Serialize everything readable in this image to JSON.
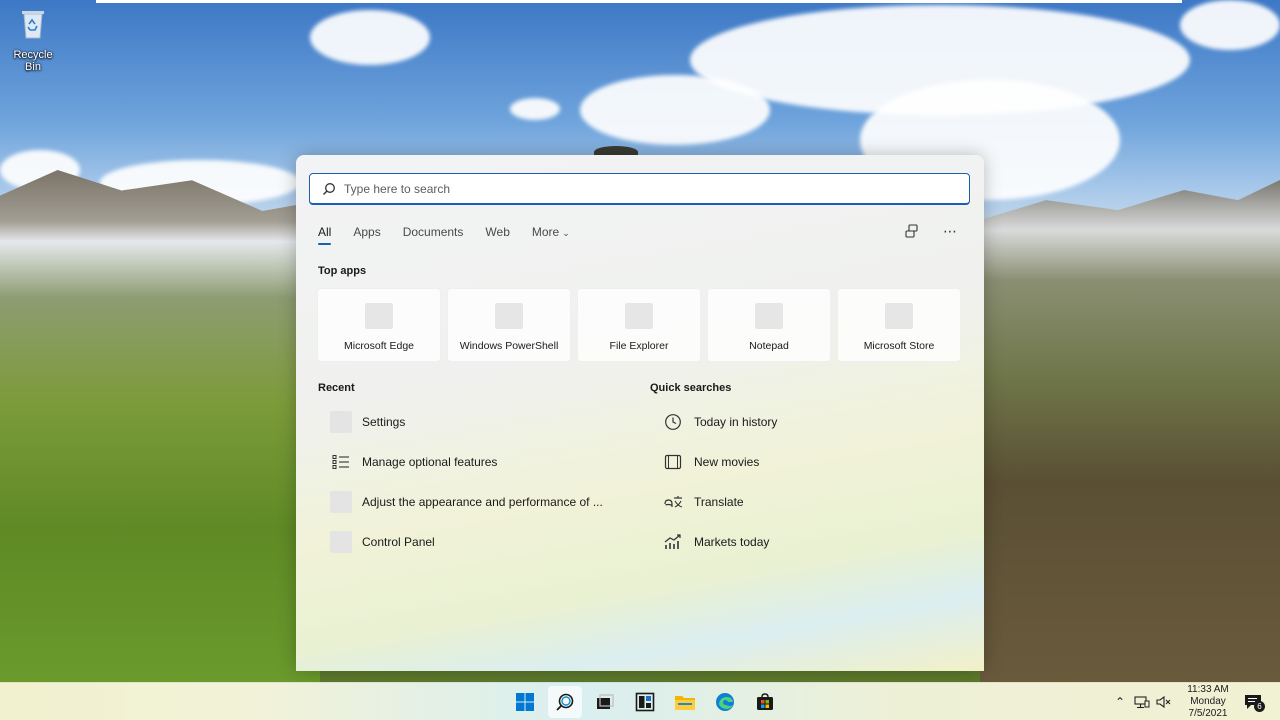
{
  "desktop": {
    "recycle_bin_label": "Recycle Bin"
  },
  "search": {
    "placeholder": "Type here to search",
    "tabs": [
      {
        "label": "All",
        "active": true
      },
      {
        "label": "Apps"
      },
      {
        "label": "Documents"
      },
      {
        "label": "Web"
      },
      {
        "label": "More"
      }
    ],
    "actions": [
      {
        "icon": "connected-accounts-icon"
      },
      {
        "icon": "more-options-icon"
      }
    ]
  },
  "top_apps": {
    "title": "Top apps",
    "items": [
      {
        "label": "Microsoft Edge"
      },
      {
        "label": "Windows PowerShell"
      },
      {
        "label": "File Explorer"
      },
      {
        "label": "Notepad"
      },
      {
        "label": "Microsoft Store"
      }
    ]
  },
  "recent": {
    "title": "Recent",
    "items": [
      {
        "label": "Settings",
        "icon": "settings-placeholder-icon"
      },
      {
        "label": "Manage optional features",
        "icon": "list-icon"
      },
      {
        "label": "Adjust the appearance and performance of ...",
        "icon": "performance-placeholder-icon"
      },
      {
        "label": "Control Panel",
        "icon": "control-panel-placeholder-icon"
      }
    ]
  },
  "quick_searches": {
    "title": "Quick searches",
    "items": [
      {
        "label": "Today in history",
        "icon": "clock-icon"
      },
      {
        "label": "New movies",
        "icon": "film-icon"
      },
      {
        "label": "Translate",
        "icon": "translate-icon"
      },
      {
        "label": "Markets today",
        "icon": "chart-icon"
      }
    ]
  },
  "taskbar": {
    "apps": [
      {
        "icon": "windows-start-icon"
      },
      {
        "icon": "search-icon",
        "active": true
      },
      {
        "icon": "task-view-icon"
      },
      {
        "icon": "widgets-icon"
      },
      {
        "icon": "file-explorer-icon"
      },
      {
        "icon": "edge-icon"
      },
      {
        "icon": "store-icon"
      }
    ],
    "tray": {
      "time": "11:33 AM",
      "day": "Monday",
      "date": "7/5/2021",
      "notification_count": "6"
    }
  },
  "colors": {
    "accent": "#1a5fb4",
    "windows_blue": "#0078d4",
    "folder_yellow": "#f2b600"
  }
}
